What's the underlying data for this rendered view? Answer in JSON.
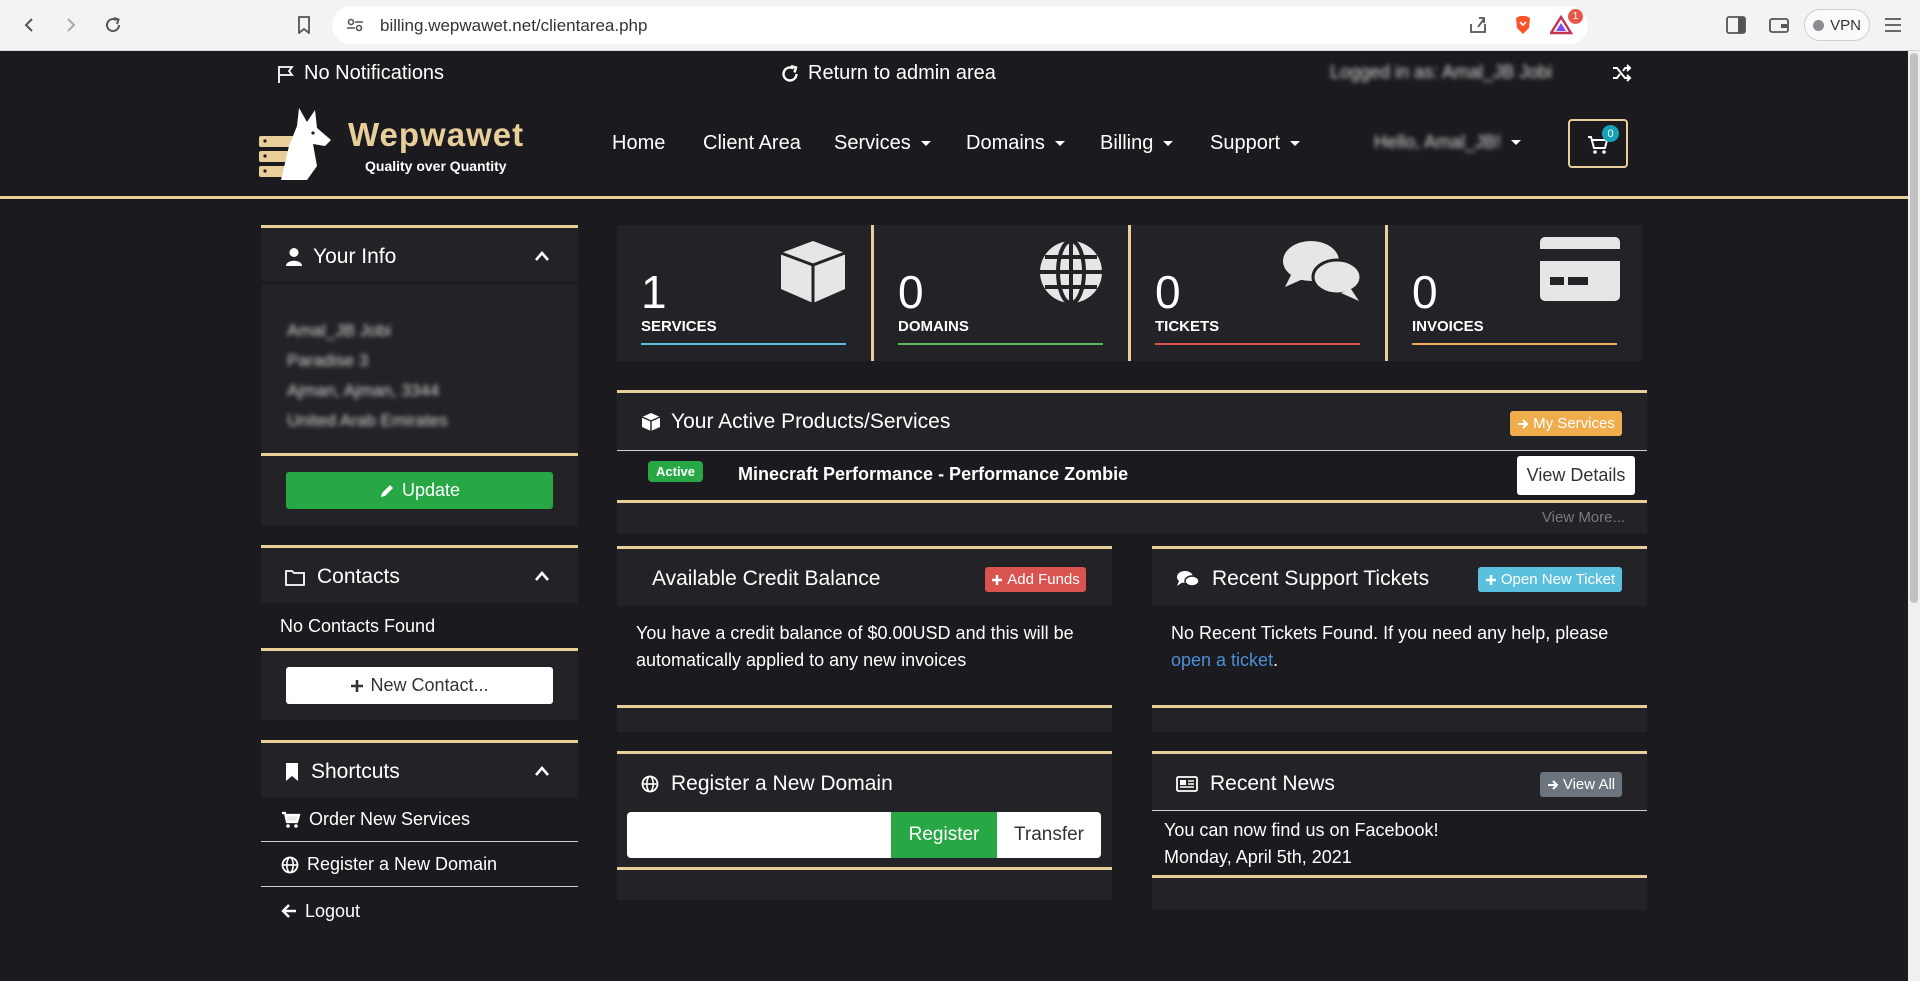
{
  "browser": {
    "url": "billing.wepwawet.net/clientarea.php",
    "vpn_label": "VPN",
    "brave_badge": "1"
  },
  "topbar": {
    "notifications": "No Notifications",
    "return_admin": "Return to admin area",
    "logged_in_as": "Logged in as: Amal_JB Jobi"
  },
  "brand": {
    "name": "Wepwawet",
    "tagline": "Quality over Quantity"
  },
  "nav": {
    "home": "Home",
    "client_area": "Client Area",
    "services": "Services",
    "domains": "Domains",
    "billing": "Billing",
    "support": "Support",
    "user": "Hello, Amal_JB!",
    "cart_count": "0"
  },
  "your_info": {
    "title": "Your Info",
    "lines": [
      "Amal_JB Jobi",
      "Paradise 3",
      "Ajman, Ajman, 3344",
      "United Arab Emirates"
    ],
    "update_label": "Update"
  },
  "contacts": {
    "title": "Contacts",
    "empty": "No Contacts Found",
    "new_label": "New Contact..."
  },
  "shortcuts": {
    "title": "Shortcuts",
    "items": [
      "Order New Services",
      "Register a New Domain",
      "Logout"
    ]
  },
  "stats": [
    {
      "value": "1",
      "label": "SERVICES",
      "color": "#5bc0de"
    },
    {
      "value": "0",
      "label": "DOMAINS",
      "color": "#5cb85c"
    },
    {
      "value": "0",
      "label": "TICKETS",
      "color": "#d9534f"
    },
    {
      "value": "0",
      "label": "INVOICES",
      "color": "#f0ad4e"
    }
  ],
  "active_products": {
    "title": "Your Active Products/Services",
    "my_services_label": "My Services",
    "status": "Active",
    "product": "Minecraft Performance - Performance Zombie",
    "view_details": "View Details",
    "view_more": "View More..."
  },
  "credit": {
    "title": "Available Credit Balance",
    "add_funds": "Add Funds",
    "text": "You have a credit balance of $0.00USD and this will be automatically applied to any new invoices"
  },
  "tickets": {
    "title": "Recent Support Tickets",
    "open_new": "Open New Ticket",
    "text_before": "No Recent Tickets Found. If you need any help, please",
    "link": "open a ticket",
    "text_after": "."
  },
  "domain": {
    "title": "Register a New Domain",
    "register": "Register",
    "transfer": "Transfer"
  },
  "news": {
    "title": "Recent News",
    "view_all": "View All",
    "headline": "You can now find us on Facebook!",
    "date": "Monday, April 5th, 2021"
  },
  "colors": {
    "gold": "#e8cf9a",
    "green": "#28a745",
    "red": "#d9534f",
    "orange": "#f0ad4e",
    "info": "#5bc0de",
    "bg": "#1b1b1f",
    "panel": "#232327"
  }
}
